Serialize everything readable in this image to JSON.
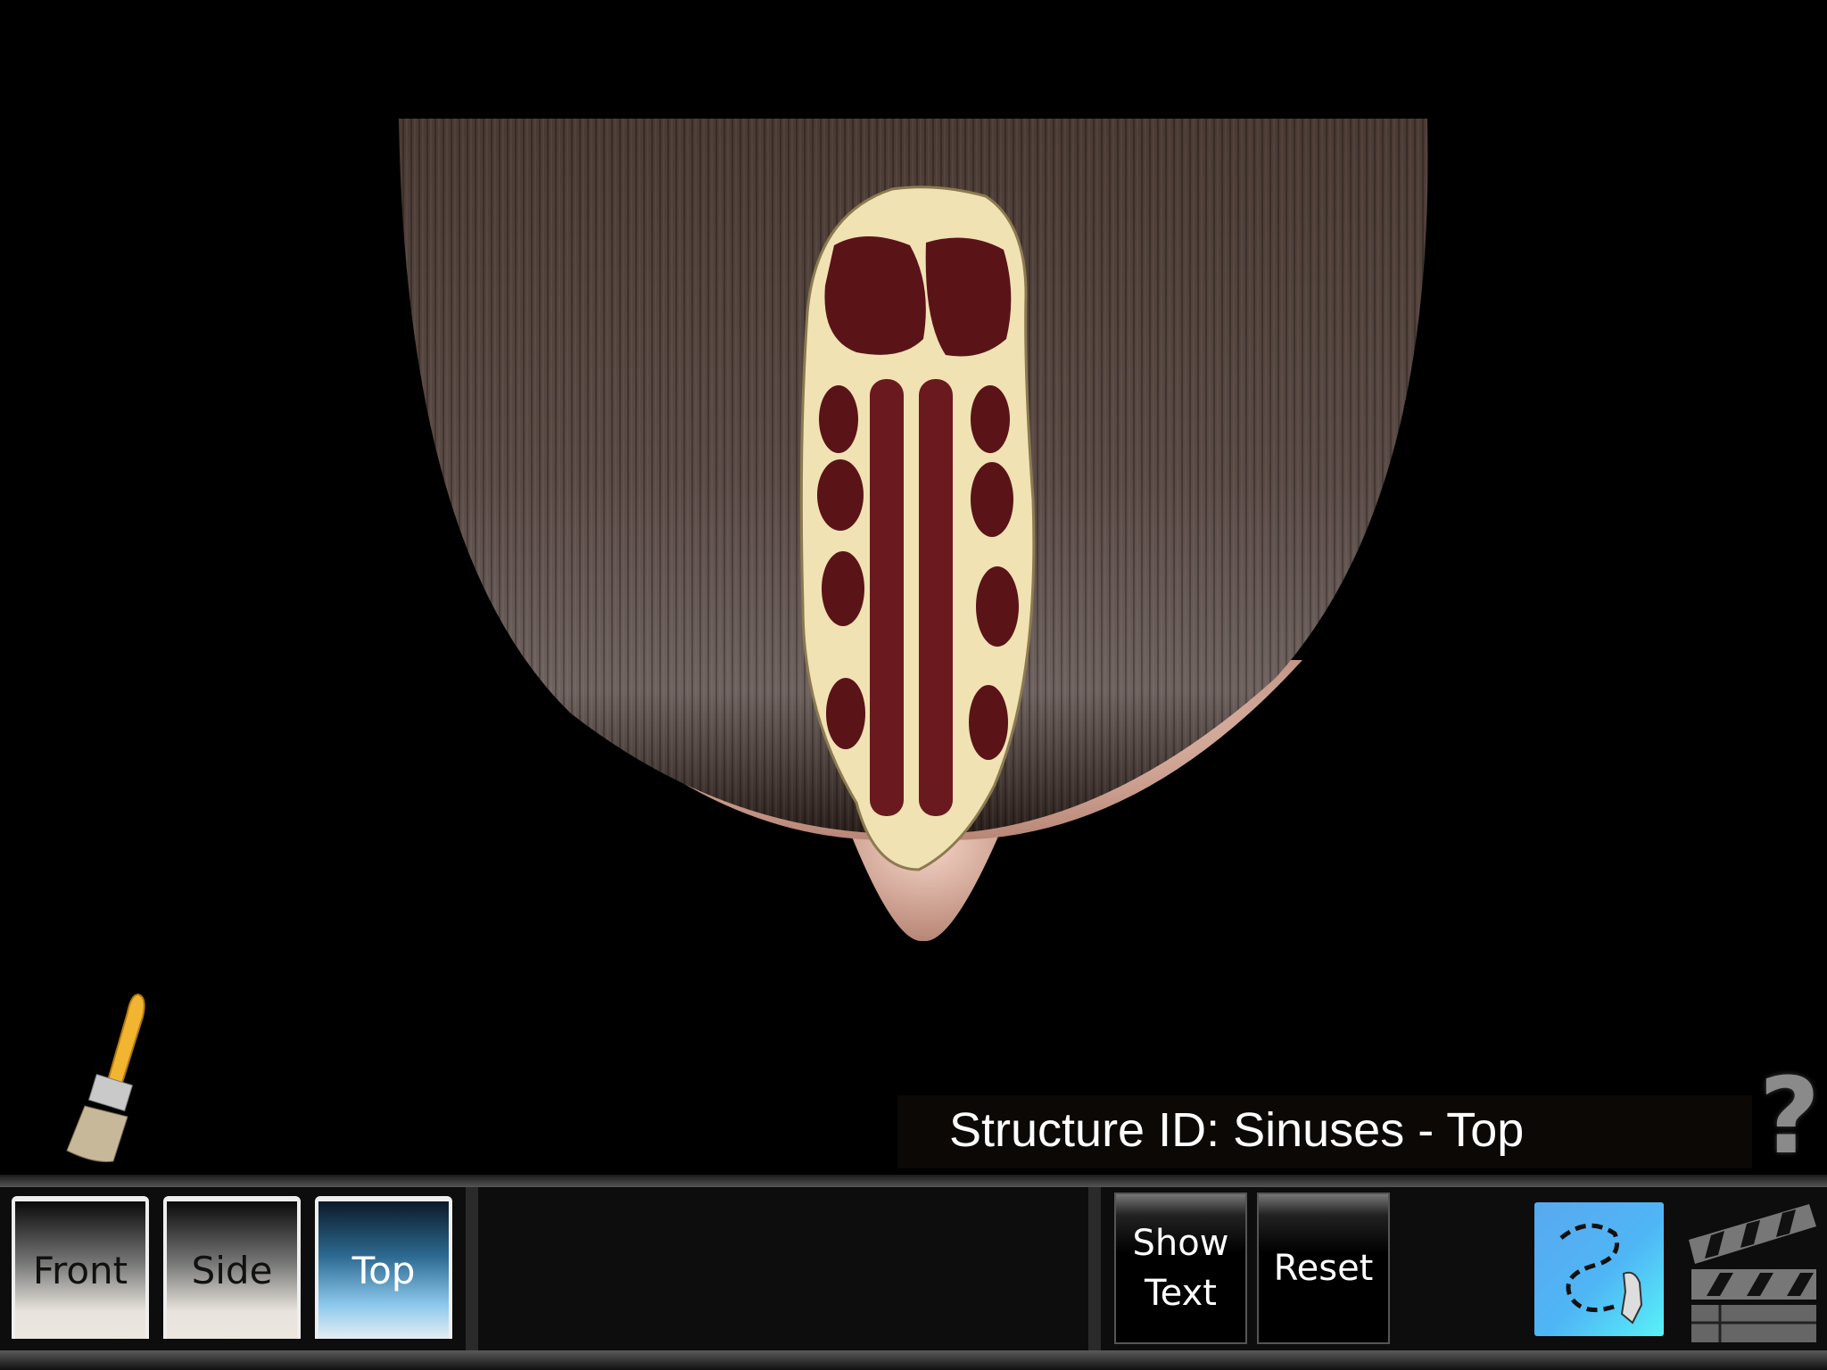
{
  "viewer": {
    "subject": "head-top-view-with-sinus-cross-section"
  },
  "label": {
    "text": "Structure ID: Sinuses - Top"
  },
  "help": {
    "glyph": "?"
  },
  "toolbar": {
    "views": [
      {
        "label": "Front",
        "selected": false
      },
      {
        "label": "Side",
        "selected": false
      },
      {
        "label": "Top",
        "selected": true
      }
    ],
    "show_text_line1": "Show",
    "show_text_line2": "Text",
    "reset_label": "Reset",
    "icons": {
      "paint": "paintbrush-icon",
      "path": "path-trace-icon",
      "movie": "clapperboard-icon",
      "help": "question-mark-icon"
    }
  },
  "colors": {
    "accent_blue": "#4fb6f5",
    "bone": "#f1e2b4",
    "sinus": "#5a1418",
    "hair": "#3a2a24"
  }
}
